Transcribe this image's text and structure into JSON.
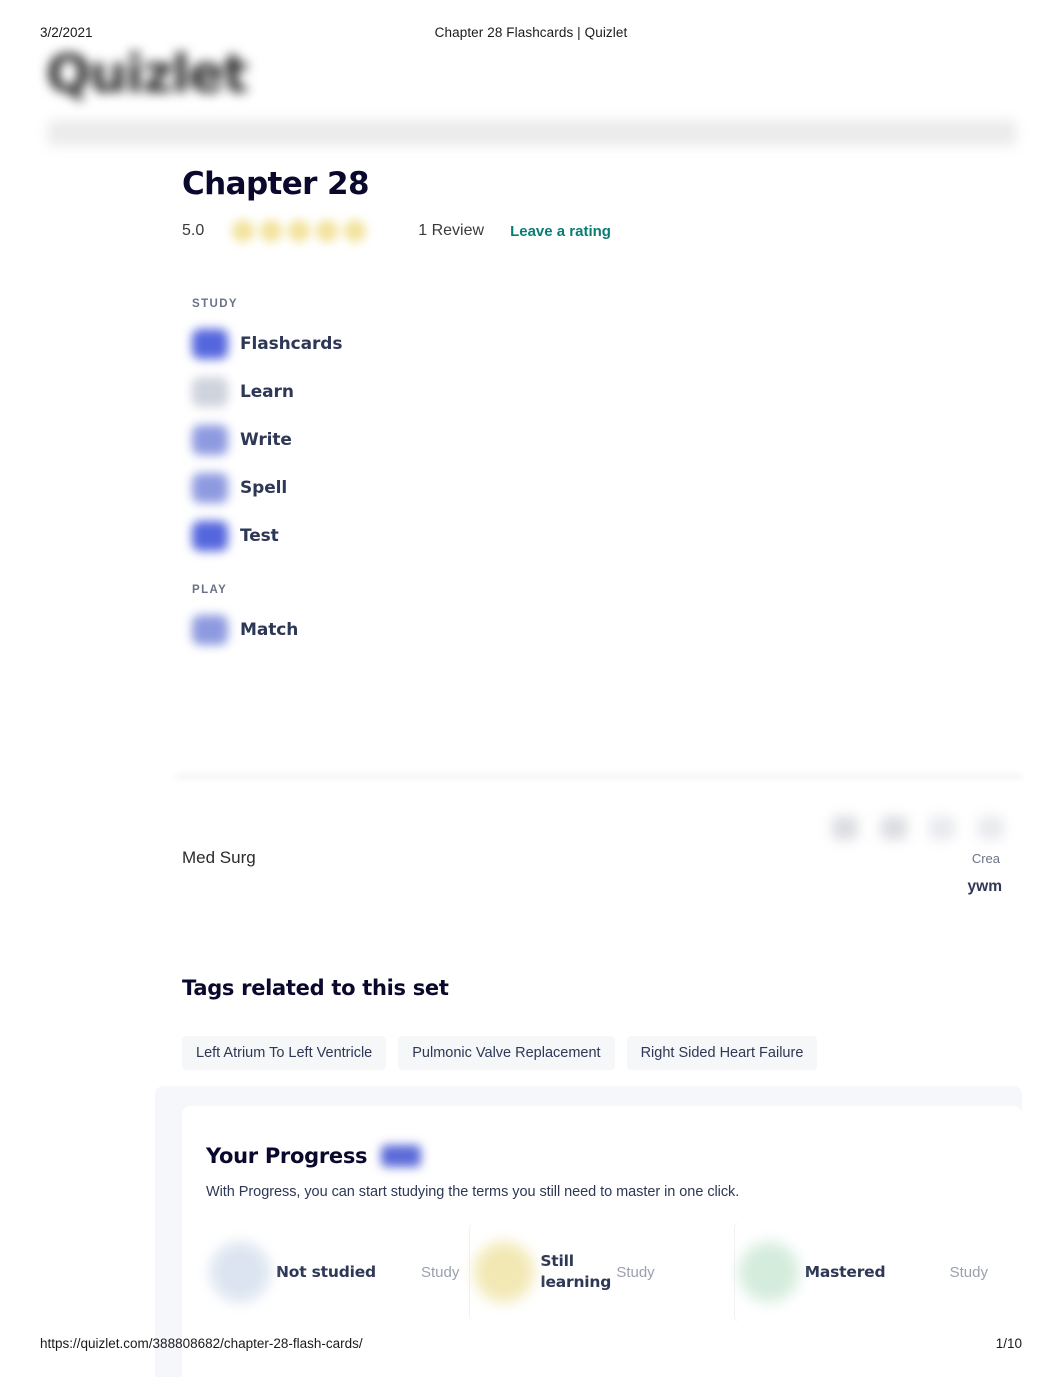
{
  "print": {
    "date": "3/2/2021",
    "document_title": "Chapter 28 Flashcards | Quizlet",
    "url": "https://quizlet.com/388808682/chapter-28-flash-cards/",
    "page_number": "1/10"
  },
  "brand": {
    "logo_text": "Quizlet",
    "accent_link_color": "#0a7d73",
    "accent_icon_color": "#5566dd"
  },
  "set": {
    "title": "Chapter 28",
    "rating_score": "5.0",
    "star_count": 5,
    "review_count": "1 Review",
    "leave_rating_label": "Leave a rating",
    "course": "Med Surg",
    "created_by_label": "Crea",
    "author": "ywm"
  },
  "modes": {
    "study_group_label": "STUDY",
    "play_group_label": "PLAY",
    "study_items": [
      {
        "label": "Flashcards",
        "icon": "flashcards-icon",
        "icon_style": "ico-blue"
      },
      {
        "label": "Learn",
        "icon": "learn-icon",
        "icon_style": "ico-grey"
      },
      {
        "label": "Write",
        "icon": "write-icon",
        "icon_style": "ico-soft"
      },
      {
        "label": "Spell",
        "icon": "spell-icon",
        "icon_style": "ico-soft"
      },
      {
        "label": "Test",
        "icon": "test-icon",
        "icon_style": "ico-blue"
      }
    ],
    "play_items": [
      {
        "label": "Match",
        "icon": "match-icon",
        "icon_style": "ico-soft"
      }
    ]
  },
  "tags": {
    "heading": "Tags related to this set",
    "items": [
      "Left Atrium To Left Ventricle",
      "Pulmonic Valve Replacement",
      "Right Sided Heart Failure"
    ]
  },
  "progress": {
    "title": "Your Progress",
    "subtitle": "With Progress, you can start studying the terms you still need to master in one click.",
    "cards": [
      {
        "label": "Not studied",
        "action": "Study",
        "color": "#dbe4f0",
        "style": "c-notstudied"
      },
      {
        "label": "Still learning",
        "action": "Study",
        "color": "#f2e8b4",
        "style": "c-learning"
      },
      {
        "label": "Mastered",
        "action": "Study",
        "color": "#d4ecdc",
        "style": "c-mastered"
      }
    ]
  }
}
